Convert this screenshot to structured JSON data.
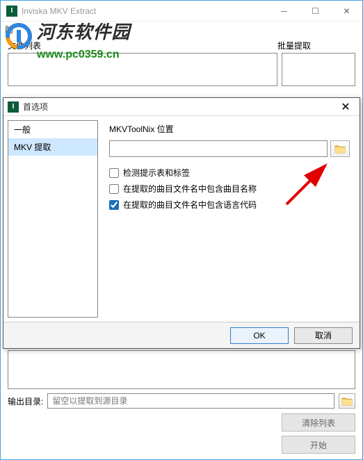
{
  "main": {
    "title": "Inviska MKV Extract",
    "menu_help": "助",
    "file_list_label": "文件列表",
    "batch_label": "批量提取",
    "output_label": "输出目录:",
    "output_placeholder": "留空以提取到源目录",
    "clear_list": "清除列表",
    "start": "开始"
  },
  "watermark": {
    "text": "河东软件园",
    "url": "www.pc0359.cn"
  },
  "pref": {
    "title": "首选项",
    "sidebar": {
      "general": "一般",
      "mkv": "MKV 提取"
    },
    "path_label": "MKVToolNix 位置",
    "check1": "检测提示表和标签",
    "check2": "在提取的曲目文件名中包含曲目名称",
    "check3": "在提取的曲目文件名中包含语言代码",
    "ok": "OK",
    "cancel": "取消"
  },
  "icons": {
    "app": "I"
  }
}
